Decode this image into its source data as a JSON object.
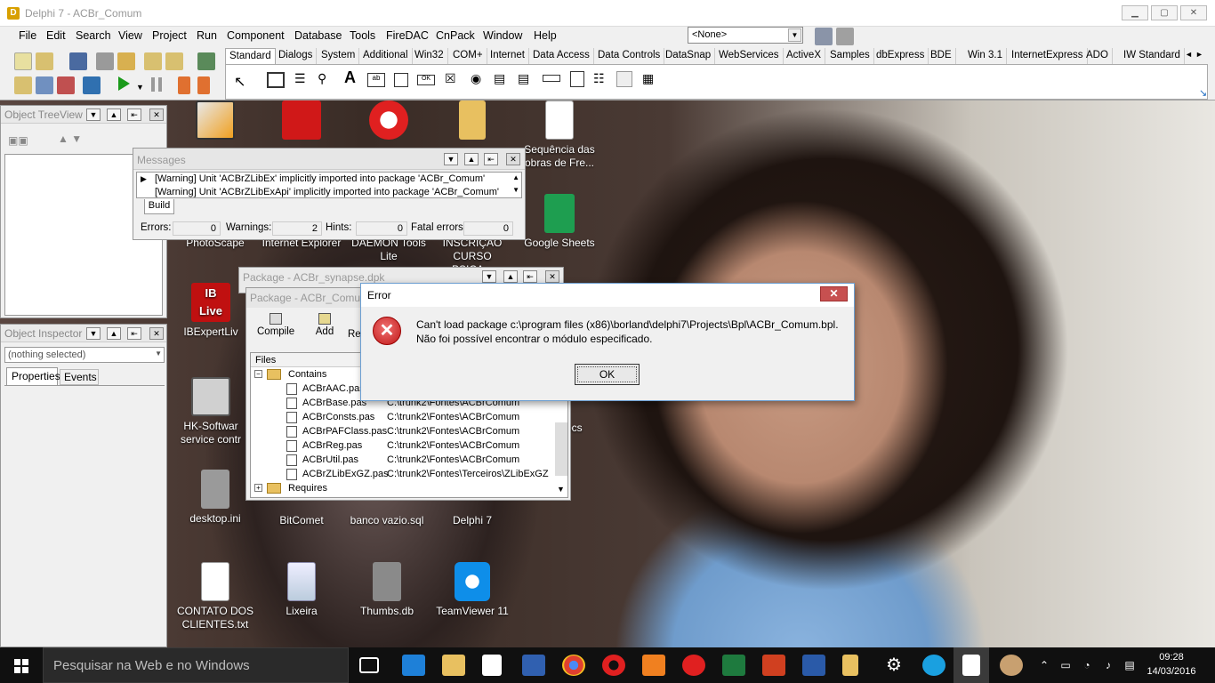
{
  "window": {
    "title": "Delphi 7 - ACBr_Comum",
    "min_label": "▁",
    "max_label": "▢",
    "close_label": "✕"
  },
  "menu": [
    "File",
    "Edit",
    "Search",
    "View",
    "Project",
    "Run",
    "Component",
    "Database",
    "Tools",
    "FireDAC",
    "CnPack",
    "Window",
    "Help"
  ],
  "toolbar": {
    "config_combo": "<None>"
  },
  "palette": {
    "tabs": [
      "Standard",
      "Dialogs",
      "System",
      "Additional",
      "Win32",
      "COM+",
      "Internet",
      "Data Access",
      "Data Controls",
      "DataSnap",
      "WebServices",
      "ActiveX",
      "Samples",
      "dbExpress",
      "BDE",
      "Win 3.1",
      "InternetExpress",
      "ADO",
      "IW Standard"
    ],
    "scroll_left": "◄",
    "scroll_right": "►"
  },
  "treeview": {
    "title": "Object TreeView"
  },
  "inspector": {
    "title": "Object Inspector",
    "selector_value": "(nothing selected)",
    "tab_properties": "Properties",
    "tab_events": "Events"
  },
  "messages": {
    "title": "Messages",
    "lines": [
      "[Warning] Unit 'ACBrZLibEx' implicitly imported into package 'ACBr_Comum'",
      "[Warning] Unit 'ACBrZLibExApi' implicitly imported into package 'ACBr_Comum'"
    ],
    "tab_build": "Build",
    "errors_label": "Errors:",
    "errors_value": "0",
    "warnings_label": "Warnings:",
    "warnings_value": "2",
    "hints_label": "Hints:",
    "hints_value": "0",
    "fatal_label": "Fatal errors:",
    "fatal_value": "0"
  },
  "package_back": {
    "title": "Package - ACBr_synapse.dpk"
  },
  "package": {
    "title": "Package - ACBr_Comum",
    "compile_label": "Compile",
    "add_label": "Add",
    "remove_label": "Re",
    "files_header": "Files",
    "contains_label": "Contains",
    "requires_label": "Requires",
    "files": [
      {
        "name": "ACBrAAC.pas",
        "path": ""
      },
      {
        "name": "ACBrBase.pas",
        "path": "C:\\trunk2\\Fontes\\ACBrComum"
      },
      {
        "name": "ACBrConsts.pas",
        "path": "C:\\trunk2\\Fontes\\ACBrComum"
      },
      {
        "name": "ACBrPAFClass.pas",
        "path": "C:\\trunk2\\Fontes\\ACBrComum"
      },
      {
        "name": "ACBrReg.pas",
        "path": "C:\\trunk2\\Fontes\\ACBrComum"
      },
      {
        "name": "ACBrUtil.pas",
        "path": "C:\\trunk2\\Fontes\\ACBrComum"
      },
      {
        "name": "ACBrZLibExGZ.pas",
        "path": "C:\\trunk2\\Fontes\\Terceiros\\ZLibExGZ"
      }
    ]
  },
  "error_dialog": {
    "title": "Error",
    "message_line1": "Can't load package c:\\program files (x86)\\borland\\delphi7\\Projects\\Bpl\\ACBr_Comum.bpl.",
    "message_line2": "Não foi possível encontrar o módulo especificado.",
    "ok_label": "OK",
    "close_label": "✕"
  },
  "desktop_icons": [
    {
      "label": "Sequência das obras de Fre...",
      "icon": "document-icon"
    },
    {
      "label": "Google Sheets",
      "icon": "sheets-icon"
    },
    {
      "label": "PhotoScape",
      "icon": "photoscape-icon"
    },
    {
      "label": "Internet Explorer",
      "icon": "ie-icon"
    },
    {
      "label": "DAEMON Tools Lite",
      "icon": "daemon-icon"
    },
    {
      "label": "INSCRIÇÃO CURSO PSICA...",
      "icon": "document-icon"
    },
    {
      "label": "IBExpertLiv",
      "icon": "ibexpert-icon"
    },
    {
      "label": "HK-Softwar service contr",
      "icon": "hk-icon"
    },
    {
      "label": "desktop.ini",
      "icon": "ini-icon"
    },
    {
      "label": "BitComet",
      "icon": "bitcomet-icon"
    },
    {
      "label": "banco vazio.sql",
      "icon": "sql-icon"
    },
    {
      "label": "Delphi 7",
      "icon": "delphi-icon"
    },
    {
      "label": "ocs",
      "icon": "folder-icon"
    },
    {
      "label": "CONTATO DOS CLIENTES.txt",
      "icon": "text-file-icon"
    },
    {
      "label": "Lixeira",
      "icon": "recycle-bin-icon"
    },
    {
      "label": "Thumbs.db",
      "icon": "db-file-icon"
    },
    {
      "label": "TeamViewer 11",
      "icon": "teamviewer-icon"
    }
  ],
  "ibexpert_badge": {
    "ib": "IB",
    "live": "Live"
  },
  "taskbar": {
    "search_placeholder": "Pesquisar na Web e no Windows",
    "time": "09:28",
    "date": "14/03/2016"
  }
}
